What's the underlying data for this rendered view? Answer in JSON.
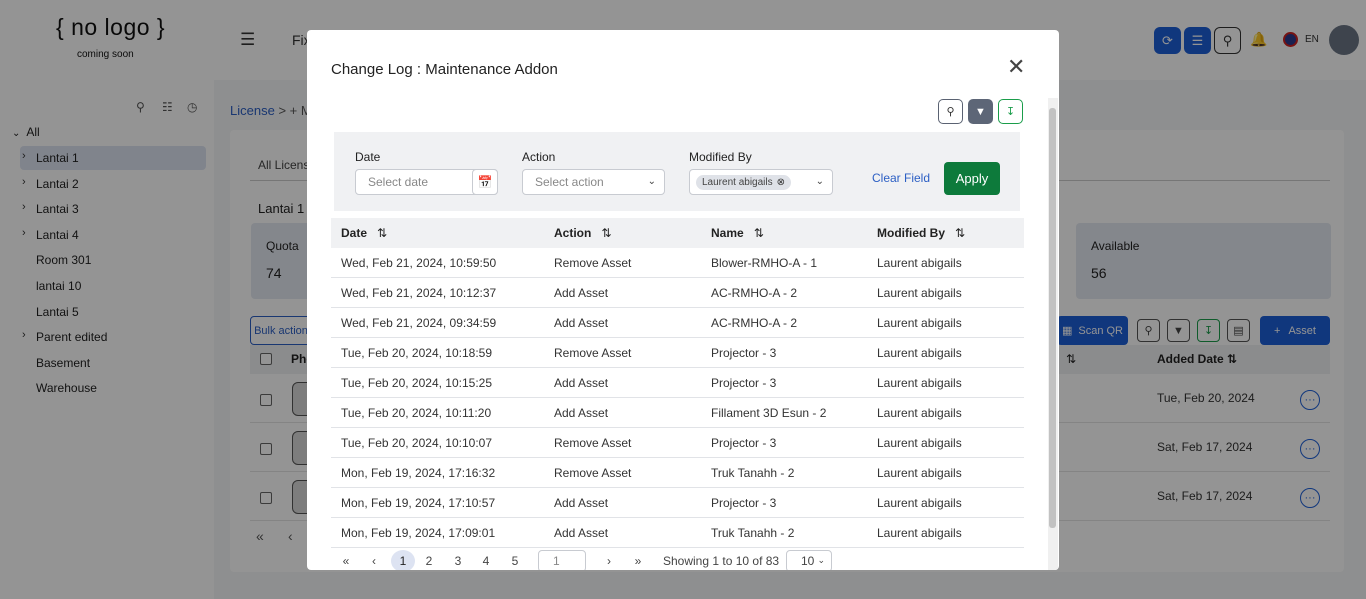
{
  "app": {
    "logo_text": "{ no logo }",
    "logo_sub": "coming soon",
    "menu_label": "Fix",
    "lang": "EN",
    "crumb": "License",
    "crumb_next": "> + M",
    "tab_label": "All Licens",
    "section_title": "Lantai 1",
    "sidebar_all": "All",
    "sidebar": [
      {
        "label": "Lantai 1",
        "chev": true
      },
      {
        "label": "Lantai 2",
        "chev": true
      },
      {
        "label": "Lantai 3",
        "chev": true
      },
      {
        "label": "Lantai 4",
        "chev": true
      },
      {
        "label": "Room 301",
        "chev": false
      },
      {
        "label": "lantai 10",
        "chev": false
      },
      {
        "label": "Lantai 5",
        "chev": false
      },
      {
        "label": "Parent edited",
        "chev": true
      },
      {
        "label": "Basement",
        "chev": false
      },
      {
        "label": "Warehouse",
        "chev": false
      }
    ],
    "quota_label": "Quota",
    "quota_value": "74",
    "available_label": "Available",
    "available_value": "56",
    "bulk_label": "Bulk action",
    "photo_col": "Pho",
    "added_date_col": "Added Date",
    "scan_qr": "Scan QR",
    "add_asset": "Asset",
    "added_dates": [
      "Tue, Feb 20, 2024",
      "Sat, Feb 17, 2024",
      "Sat, Feb 17, 2024"
    ]
  },
  "modal": {
    "title": "Change Log : Maintenance Addon",
    "filters": {
      "date_label": "Date",
      "date_placeholder": "Select date",
      "action_label": "Action",
      "action_placeholder": "Select action",
      "modified_label": "Modified By",
      "modified_chip": "Laurent abigails",
      "clear": "Clear Field",
      "apply": "Apply"
    },
    "columns": [
      "Date",
      "Action",
      "Name",
      "Modified By"
    ],
    "rows": [
      [
        "Wed, Feb 21, 2024, 10:59:50",
        "Remove Asset",
        "Blower-RMHO-A - 1",
        "Laurent abigails"
      ],
      [
        "Wed, Feb 21, 2024, 10:12:37",
        "Add Asset",
        "AC-RMHO-A - 2",
        "Laurent abigails"
      ],
      [
        "Wed, Feb 21, 2024, 09:34:59",
        "Add Asset",
        "AC-RMHO-A - 2",
        "Laurent abigails"
      ],
      [
        "Tue, Feb 20, 2024, 10:18:59",
        "Remove Asset",
        "Projector - 3",
        "Laurent abigails"
      ],
      [
        "Tue, Feb 20, 2024, 10:15:25",
        "Add Asset",
        "Projector - 3",
        "Laurent abigails"
      ],
      [
        "Tue, Feb 20, 2024, 10:11:20",
        "Add Asset",
        "Fillament 3D Esun - 2",
        "Laurent abigails"
      ],
      [
        "Tue, Feb 20, 2024, 10:10:07",
        "Remove Asset",
        "Projector - 3",
        "Laurent abigails"
      ],
      [
        "Mon, Feb 19, 2024, 17:16:32",
        "Remove Asset",
        "Truk Tanahh - 2",
        "Laurent abigails"
      ],
      [
        "Mon, Feb 19, 2024, 17:10:57",
        "Add Asset",
        "Projector - 3",
        "Laurent abigails"
      ],
      [
        "Mon, Feb 19, 2024, 17:09:01",
        "Add Asset",
        "Truk Tanahh - 2",
        "Laurent abigails"
      ]
    ],
    "pagination": {
      "pages": [
        "1",
        "2",
        "3",
        "4",
        "5"
      ],
      "current": "1",
      "page_input": "1",
      "showing": "Showing 1 to 10 of 83",
      "page_size": "10"
    }
  },
  "colors": {
    "primary": "#1d5fd8",
    "apply": "#0d7a3b",
    "download": "#1a9d4a"
  }
}
